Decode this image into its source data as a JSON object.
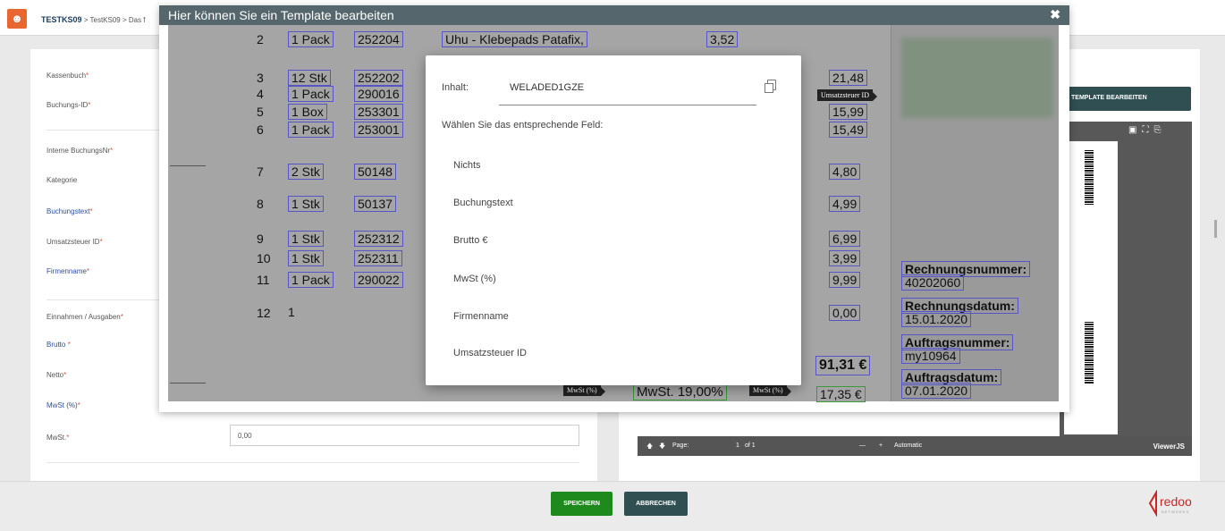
{
  "breadcrumb": {
    "app": "TESTKS09",
    "path": "> TestKS09 > Das f"
  },
  "form": {
    "labels": [
      {
        "text": "Kassenbuch",
        "req": "*"
      },
      {
        "text": "Buchungs-ID",
        "req": "*"
      },
      {
        "text": "Interne BuchungsNr",
        "req": "*"
      },
      {
        "text": "Kategorie",
        "req": ""
      },
      {
        "text": "Buchungstext",
        "req": "*"
      },
      {
        "text": "Umsatzsteuer ID",
        "req": "*"
      },
      {
        "text": "Firmenname",
        "req": "*"
      },
      {
        "text": "Einnahmen / Ausgaben",
        "req": "*"
      },
      {
        "text": "Brutto ",
        "req": "*"
      },
      {
        "text": "Netto",
        "req": "*"
      },
      {
        "text": "MwSt (%)",
        "req": "*"
      },
      {
        "text": "MwSt.",
        "req": "*"
      }
    ],
    "mwst_value": "0,00"
  },
  "right": {
    "template_button": "R TEMPLATE BEARBEITEN",
    "viewer": {
      "page_label": "Page:",
      "page_num": "1",
      "page_of": "of 1",
      "zoom": "Automatic",
      "brand": "ViewerJS"
    }
  },
  "footer": {
    "save": "SPEICHERN",
    "cancel": "ABBRECHEN",
    "brand": "redoo",
    "brand_sub": "NETWORKS"
  },
  "modal": {
    "title": "Hier können Sie ein Template bearbeiten",
    "close": "✖"
  },
  "document": {
    "rows": [
      {
        "pos": "2",
        "qty": "1 Pack",
        "art": "252204",
        "desc": "Uhu - Klebepads Patafix,",
        "unit": "3,52",
        "total": ""
      },
      {
        "pos": "3",
        "qty": "12 Stk",
        "art": "252202",
        "desc": "",
        "unit": "",
        "total": "21,48"
      },
      {
        "pos": "4",
        "qty": "1 Pack",
        "art": "290016",
        "desc": "",
        "unit": "",
        "total": ""
      },
      {
        "pos": "5",
        "qty": "1 Box",
        "art": "253301",
        "desc": "",
        "unit": "",
        "total": "15,99"
      },
      {
        "pos": "6",
        "qty": "1 Pack",
        "art": "253001",
        "desc": "",
        "unit": "",
        "total": "15,49"
      },
      {
        "pos": "7",
        "qty": "2 Stk",
        "art": "50148",
        "desc": "",
        "unit": "",
        "total": "4,80"
      },
      {
        "pos": "8",
        "qty": "1 Stk",
        "art": "50137",
        "desc": "",
        "unit": "",
        "total": "4,99"
      },
      {
        "pos": "9",
        "qty": "1 Stk",
        "art": "252312",
        "desc": "",
        "unit": "",
        "total": "6,99"
      },
      {
        "pos": "10",
        "qty": "1 Stk",
        "art": "252311",
        "desc": "",
        "unit": "",
        "total": "3,99"
      },
      {
        "pos": "11",
        "qty": "1 Pack",
        "art": "290022",
        "desc": "",
        "unit": "",
        "total": "9,99"
      },
      {
        "pos": "12",
        "qty": "1",
        "art": "",
        "desc": "",
        "unit": "",
        "total": "0,00"
      }
    ],
    "sum": "91,31 €",
    "mwst_tag": "MwSt (%)",
    "mwst_box": "MwSt. 19,00%",
    "mwst_tag2": "MwSt (%)",
    "mwst_amount": "17,35 €",
    "ust_tag": "Umsatzsteuer ID",
    "meta": [
      {
        "label": "Rechnungsnummer:",
        "value": "40202060"
      },
      {
        "label": "Rechnungsdatum:",
        "value": "15.01.2020"
      },
      {
        "label": "Auftragsnummer:",
        "value": "my10964"
      },
      {
        "label": "Auftragsdatum:",
        "value": "07.01.2020"
      }
    ]
  },
  "dialog": {
    "content_label": "Inhalt:",
    "content_value": "WELADED1GZE",
    "prompt": "Wählen Sie das entsprechende Feld:",
    "options": [
      "Nichts",
      "Buchungstext",
      "Brutto €",
      "MwSt (%)",
      "Firmenname",
      "Umsatzsteuer ID"
    ]
  }
}
